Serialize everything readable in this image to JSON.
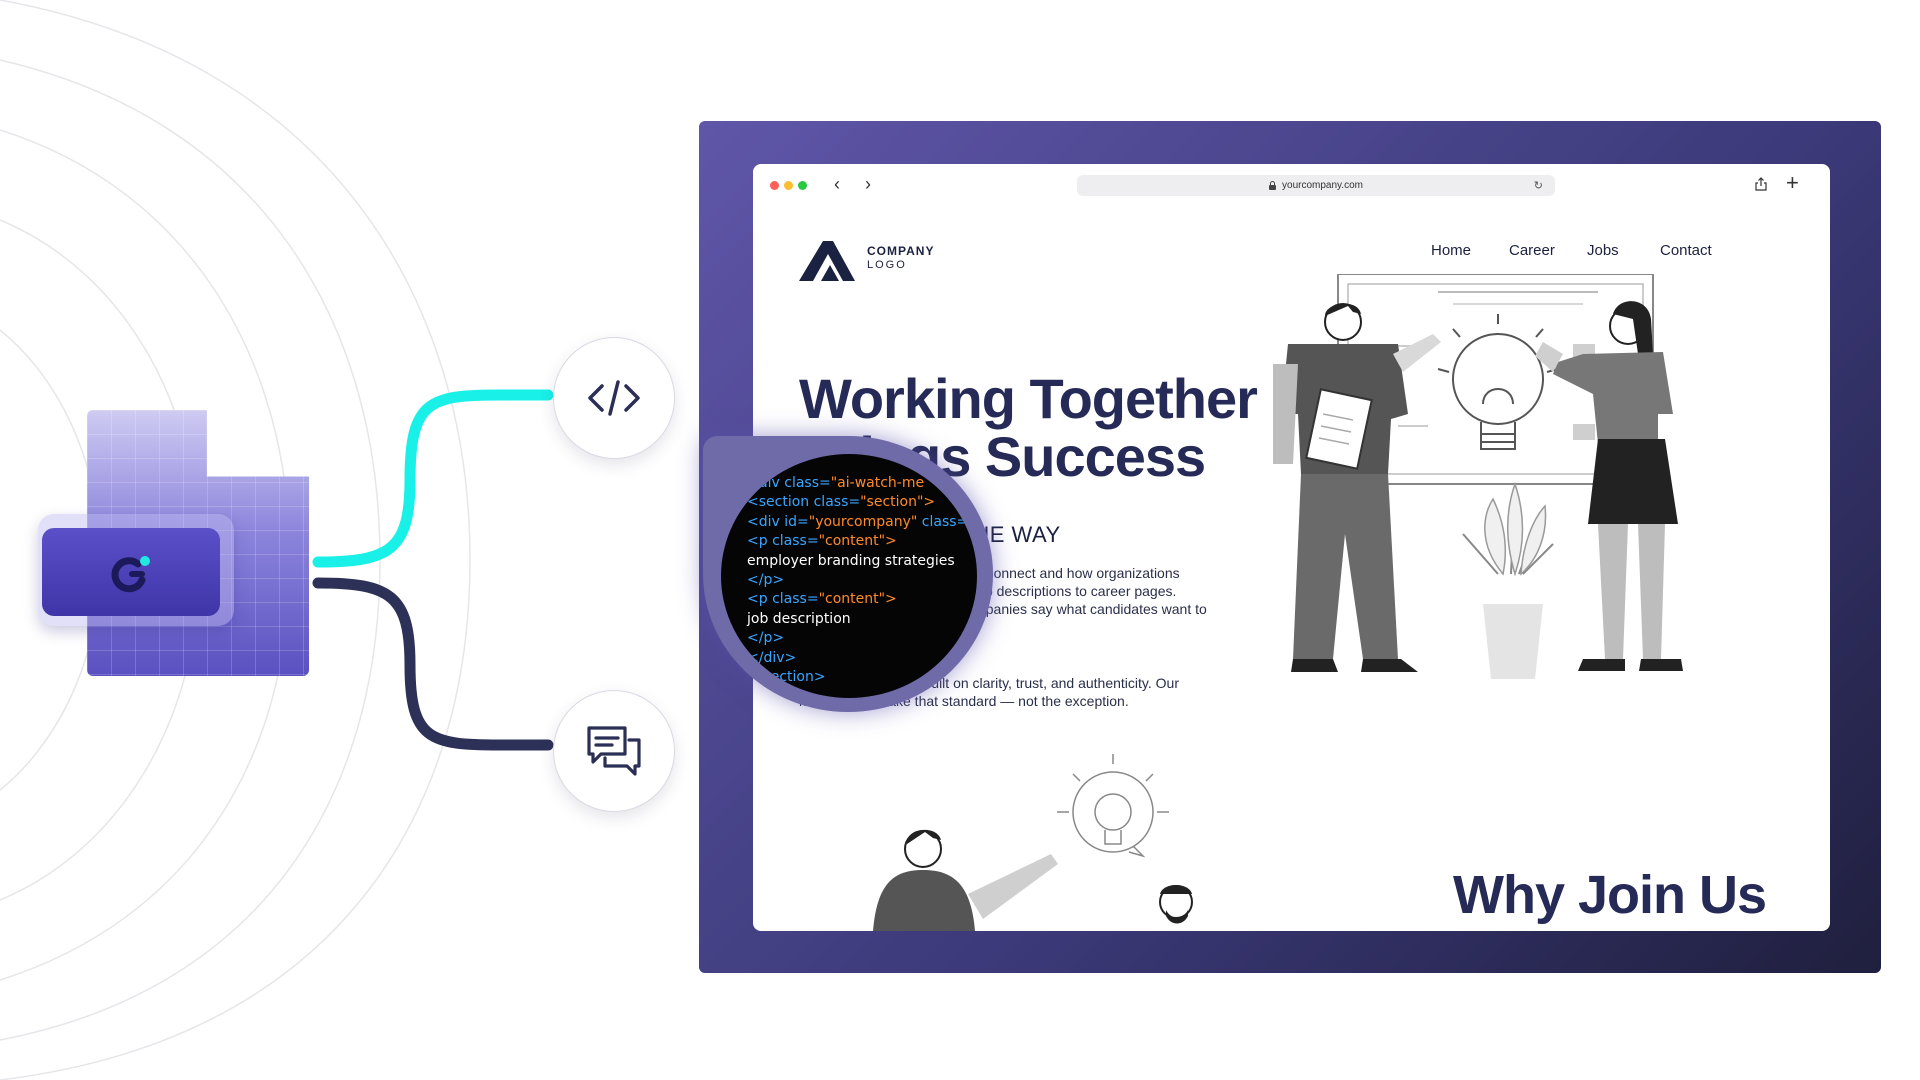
{
  "browser": {
    "url": "yourcompany.com"
  },
  "site": {
    "logo": {
      "line1": "COMPANY",
      "line2": "LOGO"
    },
    "nav": [
      {
        "label": "Home"
      },
      {
        "label": "Career"
      },
      {
        "label": "Jobs"
      },
      {
        "label": "Contact"
      }
    ],
    "hero": {
      "title_line1": "Working Together",
      "title_line2": "Brings Success",
      "subtitle": "TOGETHER IS THE WAY",
      "paragraph1": "We're reimagining how teams connect and how organizations present themselves — from job descriptions to career pages. Using strategies, we help companies say what candidates want to hear.",
      "paragraph2": "The best teams are built on clarity, trust, and authenticity. Our mission? To make that standard — not the exception."
    },
    "section_title": "Why Join Us"
  },
  "magnifier": {
    "code_lines": [
      [
        {
          "t": "<div class=",
          "c": "blue"
        },
        {
          "t": "\"ai-watch-me",
          "c": "orange"
        }
      ],
      [
        {
          "t": "<section class=",
          "c": "blue"
        },
        {
          "t": "\"section\">",
          "c": "orange"
        }
      ],
      [
        {
          "t": "<div id=",
          "c": "blue"
        },
        {
          "t": "\"yourcompany\"",
          "c": "orange"
        },
        {
          "t": " class=",
          "c": "blue"
        }
      ],
      [
        {
          "t": "<p class=",
          "c": "blue"
        },
        {
          "t": "\"content\">",
          "c": "orange"
        }
      ],
      [
        {
          "t": "employer branding strategies",
          "c": "white"
        }
      ],
      [
        {
          "t": "</p>",
          "c": "blue"
        }
      ],
      [
        {
          "t": "<p class=",
          "c": "blue"
        },
        {
          "t": "\"content\">",
          "c": "orange"
        }
      ],
      [
        {
          "t": "job description",
          "c": "white"
        }
      ],
      [
        {
          "t": "</p>",
          "c": "blue"
        }
      ],
      [
        {
          "t": "</div>",
          "c": "blue"
        }
      ],
      [
        {
          "t": "</section>",
          "c": "blue"
        }
      ]
    ]
  },
  "colors": {
    "accent_cyan": "#19f0e8",
    "accent_navy": "#2e3157",
    "frame_purple": "#5f56a8",
    "heading_navy": "#262a56"
  },
  "icons": {
    "code": "code-brackets-icon",
    "chat": "chat-bubbles-icon",
    "app": "app-logo-icon"
  }
}
